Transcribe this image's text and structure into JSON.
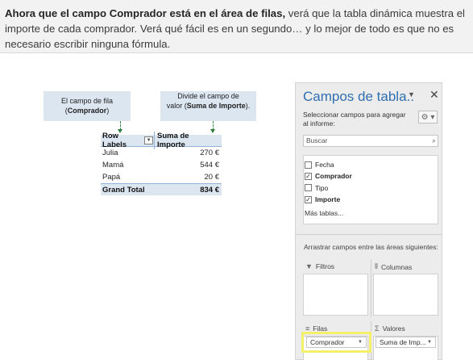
{
  "banner": {
    "bold": "Ahora que el campo Comprador está en el área de filas,",
    "text": " verá que la tabla dinámica muestra el importe de cada comprador. Verá qué fácil es en un segundo… y lo mejor de todo es que no es necesario escribir ninguna fórmula."
  },
  "callouts": {
    "left": {
      "line1": "El campo de fila",
      "open": "(",
      "bold": "Comprador",
      "close": ")"
    },
    "right": {
      "line1": "Divide el campo de",
      "line2_pre": "valor (",
      "bold": "Suma de Importe",
      "close": ")."
    }
  },
  "pivot": {
    "header": {
      "row_labels": "Row Labels",
      "value_header": "Suma de Importe"
    },
    "rows": [
      {
        "label": "Julia",
        "value": "270 €"
      },
      {
        "label": "Mamá",
        "value": "544 €"
      },
      {
        "label": "Papá",
        "value": "20 €"
      }
    ],
    "total": {
      "label": "Grand Total",
      "value": "834 €"
    }
  },
  "pane": {
    "title": "Campos de tabla..",
    "chevron_icon": "chevron-down-icon",
    "close_icon": "close-icon",
    "prompt": "Seleccionar campos para agregar al informe:",
    "gear_icon": "gear-icon",
    "search_placeholder": "Buscar",
    "fields": [
      {
        "label": "Fecha",
        "checked": false
      },
      {
        "label": "Comprador",
        "checked": true
      },
      {
        "label": "Tipo",
        "checked": false
      },
      {
        "label": "Importe",
        "checked": true
      }
    ],
    "more_tables": "Más tablas...",
    "drag_text": "Arrastrar campos entre las áreas siguientes:",
    "areas": {
      "filtros": "Filtros",
      "columnas": "Columnas",
      "filas": "Filas",
      "valores": "Valores"
    },
    "filas_item": "Comprador",
    "valores_item": "Suma de Imp...",
    "colors": {
      "accent": "#2f6fb0",
      "highlight": "#f5f06a",
      "callout": "#dce6f1"
    }
  }
}
